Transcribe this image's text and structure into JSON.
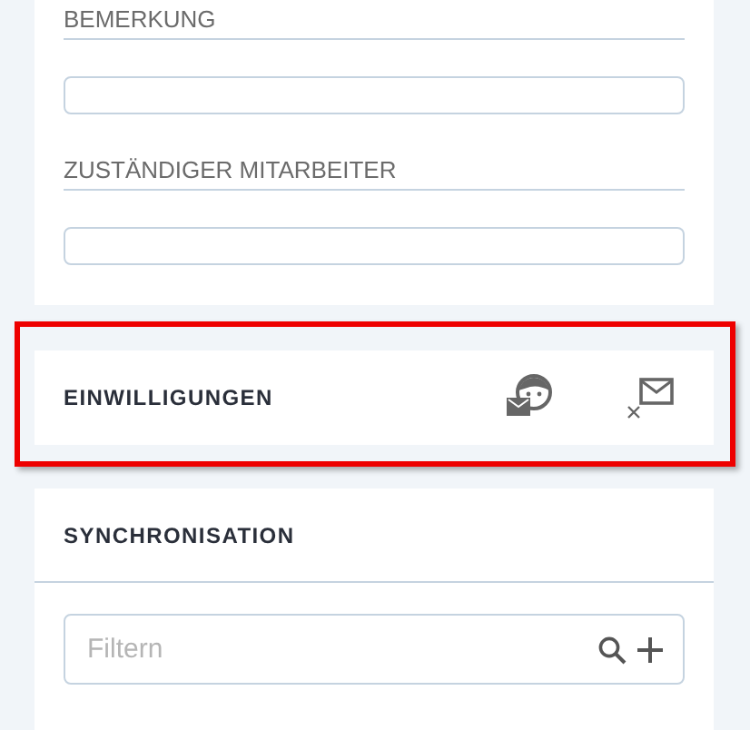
{
  "form": {
    "fields": [
      {
        "label": "BEMERKUNG"
      },
      {
        "label": "ZUSTÄNDIGER MITARBEITER"
      }
    ]
  },
  "consents": {
    "title": "EINWILLIGUNGEN",
    "highlighted": true
  },
  "sync": {
    "title": "SYNCHRONISATION",
    "filter": {
      "placeholder": "Filtern"
    }
  }
}
